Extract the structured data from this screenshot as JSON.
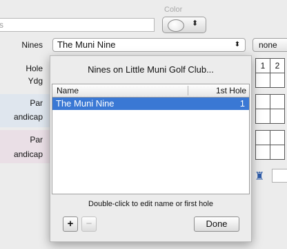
{
  "toolbar": {
    "search_placeholder": "s",
    "color_label": "Color",
    "color_arrows": "⬍"
  },
  "rows": {
    "nines_label": "Nines",
    "hole_label": "Hole",
    "ydg_label": "Ydg",
    "par_label_1": "Par",
    "handicap_label_1": "andicap",
    "par_label_2": "Par",
    "handicap_label_2": "andicap"
  },
  "nines_select": {
    "value": "The Muni Nine",
    "arrows": "⬍"
  },
  "none_popup": {
    "value": "none"
  },
  "hole_numbers": [
    "1",
    "2"
  ],
  "sheet": {
    "title": "Nines on Little Muni Golf Club...",
    "columns": {
      "name": "Name",
      "first_hole": "1st Hole"
    },
    "rows": [
      {
        "name": "The Muni Nine",
        "first_hole": "1"
      }
    ],
    "hint": "Double-click to edit name or first hole",
    "add_label": "+",
    "remove_label": "−",
    "done_label": "Done"
  },
  "icons": {
    "person": "♜"
  },
  "colors": {
    "selection": "#3a78d4"
  }
}
